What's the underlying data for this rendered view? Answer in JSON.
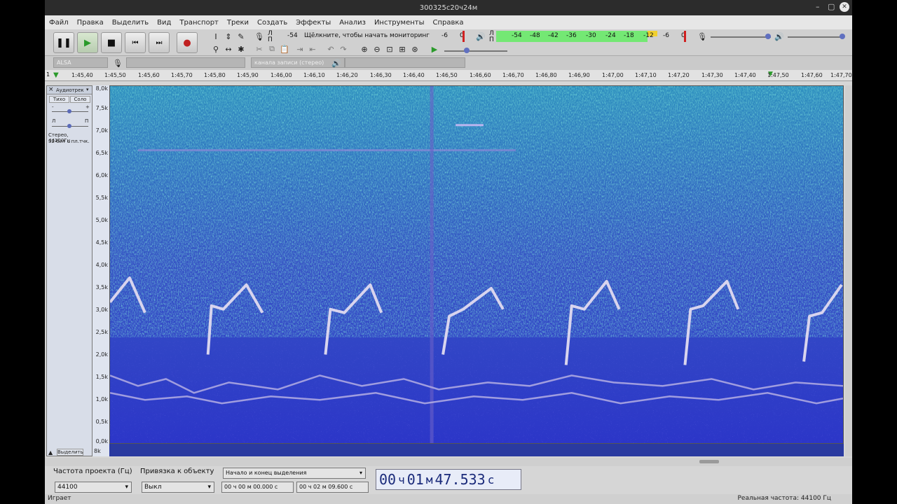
{
  "window": {
    "title": "300325с20ч24м"
  },
  "menu": [
    "Файл",
    "Правка",
    "Выделить",
    "Вид",
    "Транспорт",
    "Треки",
    "Создать",
    "Эффекты",
    "Анализ",
    "Инструменты",
    "Справка"
  ],
  "meters": {
    "rec_lr": [
      "Л",
      "П"
    ],
    "rec_ticks": [
      "-54",
      "-6",
      "0"
    ],
    "monitor_text": "Щёлкните, чтобы начать мониторинг",
    "play_ticks": [
      "-54",
      "-48",
      "-42",
      "-36",
      "-30",
      "-24",
      "-18",
      "-12",
      "-6",
      "0"
    ]
  },
  "devices": {
    "host": "ALSA",
    "channels": "канала записи (стерео)"
  },
  "ruler": [
    "1:45,40",
    "1:45,50",
    "1:45,60",
    "1:45,70",
    "1:45,80",
    "1:45,90",
    "1:46,00",
    "1:46,10",
    "1:46,20",
    "1:46,30",
    "1:46,40",
    "1:46,50",
    "1:46,60",
    "1:46,70",
    "1:46,80",
    "1:46,90",
    "1:47,00",
    "1:47,10",
    "1:47,20",
    "1:47,30",
    "1:47,40",
    "1:47,50",
    "1:47,60",
    "1:47,70"
  ],
  "track": {
    "name": "Аудиотрек",
    "mute": "Тихо",
    "solo": "Соло",
    "gain_minus": "-",
    "gain_plus": "+",
    "pan_l": "Л",
    "pan_r": "П",
    "info1": "Стерео, 44100Гц",
    "info2": "32-бит с пл.тчк.",
    "select": "Выделить"
  },
  "scale": [
    "8,0k",
    "7,5k",
    "7,0k",
    "6,5k",
    "6,0k",
    "5,5k",
    "5,0k",
    "4,5k",
    "4,0k",
    "3,5k",
    "3,0k",
    "2,5k",
    "2,0k",
    "1,5k",
    "1,0k",
    "0,5k",
    "0,0k"
  ],
  "clip_label": "8k",
  "selection": {
    "rate_label": "Частота проекта (Гц)",
    "rate_value": "44100",
    "snap_label": "Привязка к объекту",
    "snap_value": "Выкл",
    "mode_value": "Начало и конец выделения",
    "start": "00 ч 00 м 00.000 с",
    "end": "00 ч 02 м 09.600 с",
    "pos_h": "00",
    "pos_h_unit": "ч",
    "pos_m": "01",
    "pos_m_unit": "м",
    "pos_s": "47.533",
    "pos_s_unit": "с"
  },
  "status": {
    "left": "Играет",
    "right": "Реальная частота: 44100 Гц"
  },
  "colors": {
    "spectro_bg": "#2f45c8",
    "spectro_hot": "#36b8b0",
    "call": "#d8d4ee"
  }
}
